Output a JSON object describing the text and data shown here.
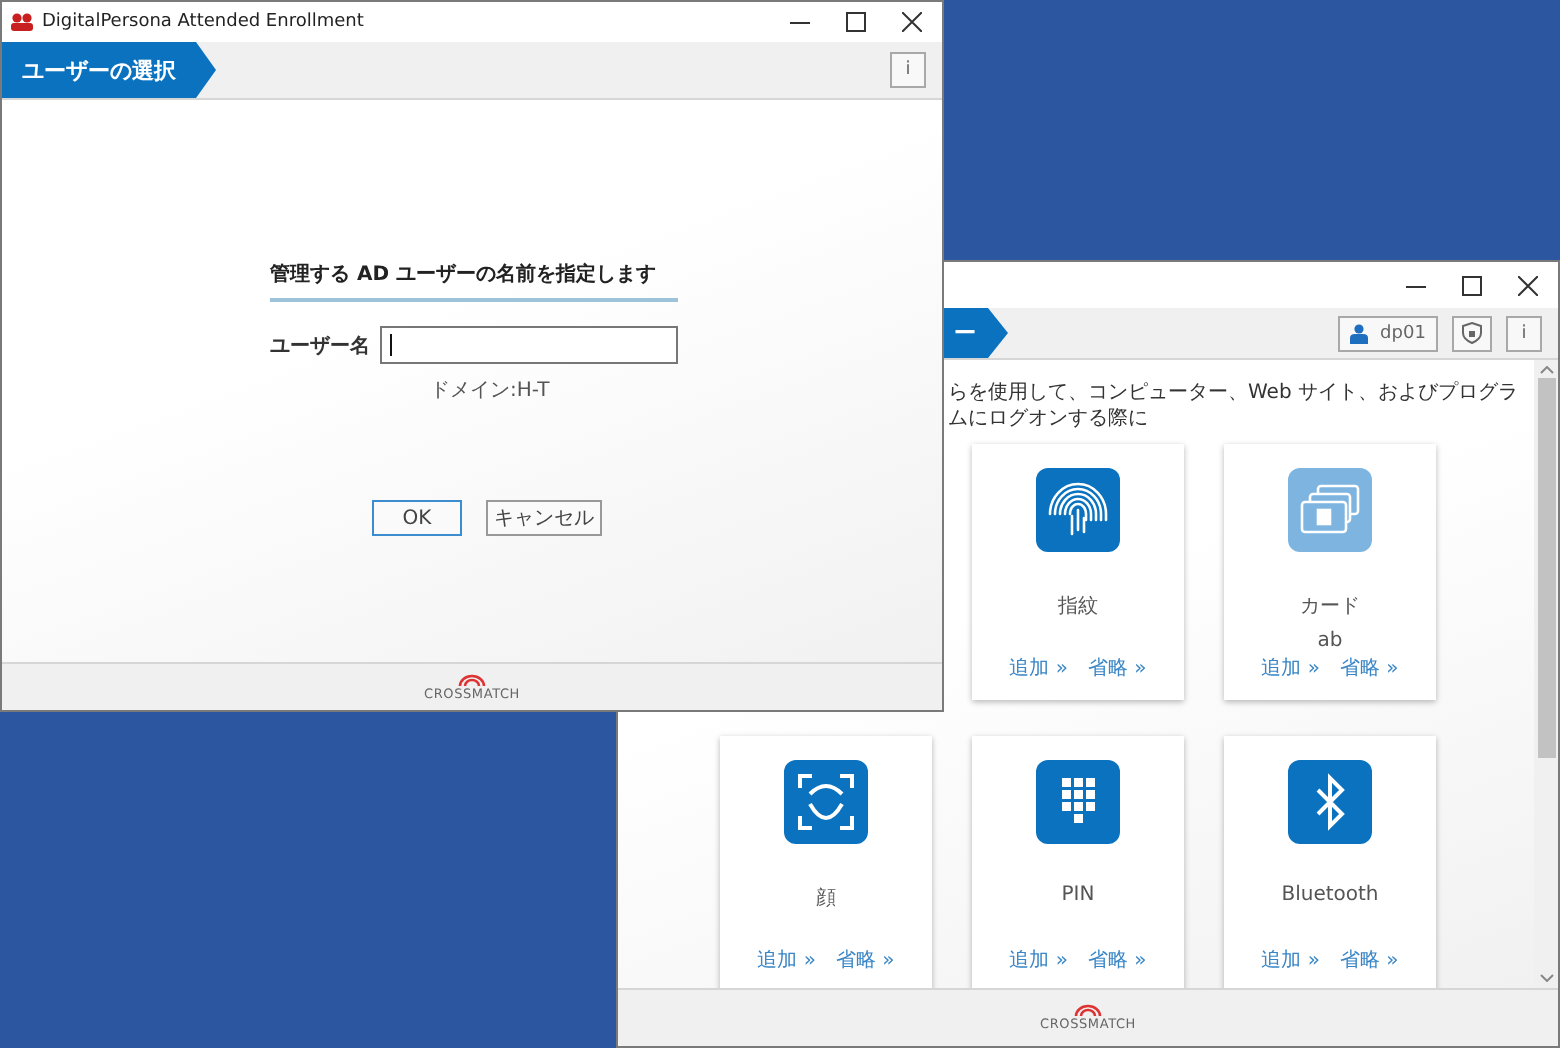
{
  "front_window": {
    "title": "DigitalPersona Attended Enrollment",
    "step": "ユーザーの選択",
    "info": "i",
    "form": {
      "heading": "管理する AD ユーザーの名前を指定します",
      "username_label": "ユーザー名",
      "username": {
        "focused": true
      },
      "domain": "ドメイン:H-T",
      "buttons": [
        {
          "label": "OK",
          "default": true
        },
        {
          "label": "キャンセル",
          "default": false
        }
      ]
    },
    "logo": "CROSSMATCH"
  },
  "back_window": {
    "step": "ー",
    "user": "dp01",
    "info": "i",
    "description": "らを使用して、コンピューター、Web サイト、およびプログラムにログオンする際に",
    "cards": [
      {
        "kind": "fingerprint",
        "label": "指紋",
        "color": "#0a72bf",
        "add": "追加 »",
        "skip": "省略 »"
      },
      {
        "kind": "card",
        "label": "カード",
        "detail": "ab",
        "color": "#7db5e0",
        "add": "追加 »",
        "skip": "省略 »"
      },
      {
        "kind": "face",
        "label": "顔",
        "color": "#0a72bf",
        "add": "追加 »",
        "skip": "省略 »"
      },
      {
        "kind": "pin",
        "label": "PIN",
        "color": "#0a72bf",
        "add": "追加 »",
        "skip": "省略 »"
      },
      {
        "kind": "bluetooth",
        "label": "Bluetooth",
        "color": "#0a72bf",
        "add": "追加 »",
        "skip": "省略 »"
      }
    ],
    "logo": "CROSSMATCH"
  }
}
